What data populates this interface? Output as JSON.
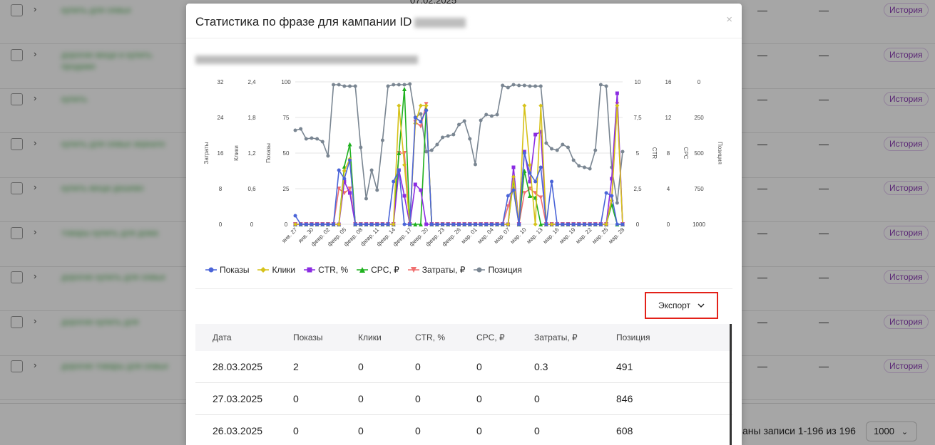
{
  "background": {
    "top_date": "07.02.2025",
    "history_label": "История",
    "dash": "—",
    "rows": [
      {
        "phrase": "купить для семьи"
      },
      {
        "phrase": "дорогие вещи и купить продаже"
      },
      {
        "phrase": "купить"
      },
      {
        "phrase": "купить для семьи зеркало"
      },
      {
        "phrase": "купить вещи дешево"
      },
      {
        "phrase": "товары купить для дома"
      },
      {
        "phrase": "дорогие купить для семьи"
      },
      {
        "phrase": "дорогие купить для"
      },
      {
        "phrase": "дорогие товары для семьи"
      }
    ],
    "footer": {
      "records_text": "аны записи 1-196 из 196",
      "per_page": "1000"
    }
  },
  "modal": {
    "title": "Статистика по фразе для кампании ID",
    "close": "×",
    "phrase": "дорогие вещи купить продаже"
  },
  "legend": [
    {
      "name": "Показы",
      "color": "#4a64d8",
      "marker": "circle"
    },
    {
      "name": "Клики",
      "color": "#d6c21a",
      "marker": "diamond"
    },
    {
      "name": "CTR, %",
      "color": "#8a2be2",
      "marker": "square"
    },
    {
      "name": "CPC, ₽",
      "color": "#1fb11f",
      "marker": "triangle"
    },
    {
      "name": "Затраты, ₽",
      "color": "#f07070",
      "marker": "triangle-down"
    },
    {
      "name": "Позиция",
      "color": "#7a8692",
      "marker": "circle"
    }
  ],
  "export_label": "Экспорт",
  "table": {
    "headers": [
      "Дата",
      "Показы",
      "Клики",
      "CTR, %",
      "CPC, ₽",
      "Затраты, ₽",
      "Позиция"
    ],
    "rows": [
      [
        "28.03.2025",
        "2",
        "0",
        "0",
        "0",
        "0.3",
        "491"
      ],
      [
        "27.03.2025",
        "0",
        "0",
        "0",
        "0",
        "0",
        "846"
      ],
      [
        "26.03.2025",
        "0",
        "0",
        "0",
        "0",
        "0",
        "608"
      ]
    ]
  },
  "chart_data": {
    "type": "line",
    "x": [
      "янв. 27",
      "янв. 28",
      "янв. 29",
      "янв. 30",
      "янв. 31",
      "февр. 01",
      "февр. 02",
      "февр. 03",
      "февр. 04",
      "февр. 05",
      "февр. 06",
      "февр. 07",
      "февр. 08",
      "февр. 09",
      "февр. 10",
      "февр. 11",
      "февр. 12",
      "февр. 13",
      "февр. 14",
      "февр. 15",
      "февр. 16",
      "февр. 17",
      "февр. 18",
      "февр. 19",
      "февр. 20",
      "февр. 21",
      "февр. 22",
      "февр. 23",
      "февр. 24",
      "февр. 25",
      "февр. 26",
      "февр. 27",
      "февр. 28",
      "мар. 01",
      "мар. 02",
      "мар. 03",
      "мар. 04",
      "мар. 05",
      "мар. 06",
      "мар. 07",
      "мар. 08",
      "мар. 09",
      "мар. 10",
      "мар. 11",
      "мар. 12",
      "мар. 13",
      "мар. 14",
      "мар. 15",
      "мар. 16",
      "мар. 17",
      "мар. 18",
      "мар. 19",
      "мар. 20",
      "мар. 21",
      "мар. 22",
      "мар. 23",
      "мар. 24",
      "мар. 25",
      "мар. 26",
      "мар. 27",
      "мар. 28"
    ],
    "x_tick_labels": [
      "янв. 27",
      "янв. 30",
      "февр. 02",
      "февр. 05",
      "февр. 08",
      "февр. 11",
      "февр. 14",
      "февр. 17",
      "февр. 20",
      "февр. 23",
      "февр. 26",
      "мар. 01",
      "мар. 04",
      "мар. 07",
      "мар. 10",
      "мар. 13",
      "мар. 16",
      "мар. 19",
      "мар. 22",
      "мар. 25",
      "мар. 28"
    ],
    "axes": [
      {
        "label": "Затраты",
        "side": "left",
        "ticks": [
          "0",
          "8",
          "16",
          "24",
          "32"
        ],
        "range": [
          0,
          32
        ]
      },
      {
        "label": "Клики",
        "side": "left",
        "ticks": [
          "0",
          "0,6",
          "1,2",
          "1,8",
          "2,4"
        ],
        "range": [
          0,
          2.4
        ]
      },
      {
        "label": "Показы",
        "side": "left",
        "ticks": [
          "0",
          "25",
          "50",
          "75",
          "100"
        ],
        "range": [
          0,
          100
        ]
      },
      {
        "label": "CTR",
        "side": "right",
        "ticks": [
          "0",
          "2,5",
          "5",
          "7,5",
          "10"
        ],
        "range": [
          0,
          10
        ]
      },
      {
        "label": "CPC",
        "side": "right",
        "ticks": [
          "0",
          "4",
          "8",
          "12",
          "16"
        ],
        "range": [
          0,
          16
        ]
      },
      {
        "label": "Позиция",
        "side": "right",
        "ticks": [
          "1000",
          "750",
          "500",
          "250",
          "0"
        ],
        "range": [
          1000,
          0
        ],
        "inverted": true
      }
    ],
    "grid": true,
    "legend_position": "bottom-left",
    "series": [
      {
        "name": "Показы",
        "axis": "Показы",
        "values": [
          6,
          0,
          0,
          0,
          0,
          0,
          0,
          0,
          38,
          32,
          45,
          0,
          0,
          0,
          0,
          0,
          0,
          0,
          30,
          38,
          0,
          0,
          75,
          72,
          80,
          0,
          0,
          0,
          0,
          0,
          0,
          0,
          0,
          0,
          0,
          0,
          0,
          0,
          0,
          20,
          24,
          0,
          50,
          36,
          30,
          40,
          0,
          30,
          0,
          0,
          0,
          0,
          0,
          0,
          0,
          0,
          0,
          22,
          20,
          0,
          0,
          0
        ]
      },
      {
        "name": "Клики",
        "axis": "Клики",
        "values": [
          0,
          0,
          0,
          0,
          0,
          0,
          0,
          0,
          0,
          0.9,
          1.1,
          0,
          0,
          0,
          0,
          0,
          0,
          0,
          0,
          2.0,
          1.0,
          0,
          1.7,
          2.0,
          2.0,
          0,
          0,
          0,
          0,
          0,
          0,
          0,
          0,
          0,
          0,
          0,
          0,
          0,
          0,
          0,
          0.8,
          0,
          2.0,
          1.0,
          0,
          2.0,
          0,
          0,
          0,
          0,
          0,
          0,
          0,
          0,
          0,
          0,
          0,
          0,
          0.4,
          2.0,
          0,
          0
        ]
      },
      {
        "name": "CTR, %",
        "axis": "CTR",
        "values": [
          0,
          0,
          0,
          0,
          0,
          0,
          0,
          0,
          0,
          3.0,
          2.2,
          0,
          0,
          0,
          0,
          0,
          0,
          0,
          0,
          3.8,
          2.0,
          0,
          2.8,
          2.4,
          0,
          0,
          0,
          0,
          0,
          0,
          0,
          0,
          0,
          0,
          0,
          0,
          0,
          0,
          0,
          0,
          4.0,
          0,
          5.1,
          3.0,
          6.3,
          6.5,
          0,
          0,
          0,
          0,
          0,
          0,
          0,
          0,
          0,
          0,
          0,
          0,
          3.2,
          9.2,
          0,
          0
        ]
      },
      {
        "name": "CPC, ₽",
        "axis": "CPC",
        "values": [
          0,
          0,
          0,
          0,
          0,
          0,
          0,
          0,
          0,
          6.5,
          9.0,
          0,
          0,
          0,
          0,
          0,
          0,
          0,
          0,
          8.0,
          15.2,
          0,
          0,
          0,
          13.0,
          0,
          0,
          0,
          0,
          0,
          0,
          0,
          0,
          0,
          0,
          0,
          0,
          0,
          0,
          0,
          5.0,
          0,
          6.0,
          3.2,
          3.0,
          0,
          0,
          0,
          0,
          0,
          0,
          0,
          0,
          0,
          0,
          0,
          0,
          0,
          2.2,
          0,
          0,
          0
        ]
      },
      {
        "name": "Затраты, ₽",
        "axis": "Затраты",
        "values": [
          0,
          0,
          0,
          0,
          0,
          0,
          0,
          0,
          8,
          7,
          8,
          0,
          0,
          0,
          0,
          0,
          0,
          0,
          0,
          16,
          16,
          0,
          23,
          22,
          27,
          0,
          0,
          0,
          0,
          0,
          0,
          0,
          0,
          0,
          0,
          0,
          0,
          0,
          0,
          4,
          8,
          0,
          7,
          8,
          7,
          6,
          0,
          0,
          0,
          0,
          0,
          0,
          0,
          0,
          0,
          0,
          0,
          0,
          6,
          27,
          0,
          0
        ]
      },
      {
        "name": "Позиция",
        "axis": "Позиция",
        "values": [
          340,
          330,
          400,
          395,
          400,
          420,
          520,
          20,
          20,
          30,
          30,
          30,
          460,
          820,
          620,
          760,
          410,
          30,
          20,
          20,
          20,
          15,
          250,
          225,
          490,
          480,
          440,
          390,
          380,
          370,
          300,
          275,
          400,
          580,
          270,
          230,
          240,
          230,
          25,
          40,
          20,
          25,
          25,
          30,
          30,
          30,
          430,
          470,
          480,
          440,
          460,
          550,
          590,
          600,
          610,
          480,
          20,
          30,
          600,
          850,
          490,
          490
        ]
      }
    ]
  }
}
